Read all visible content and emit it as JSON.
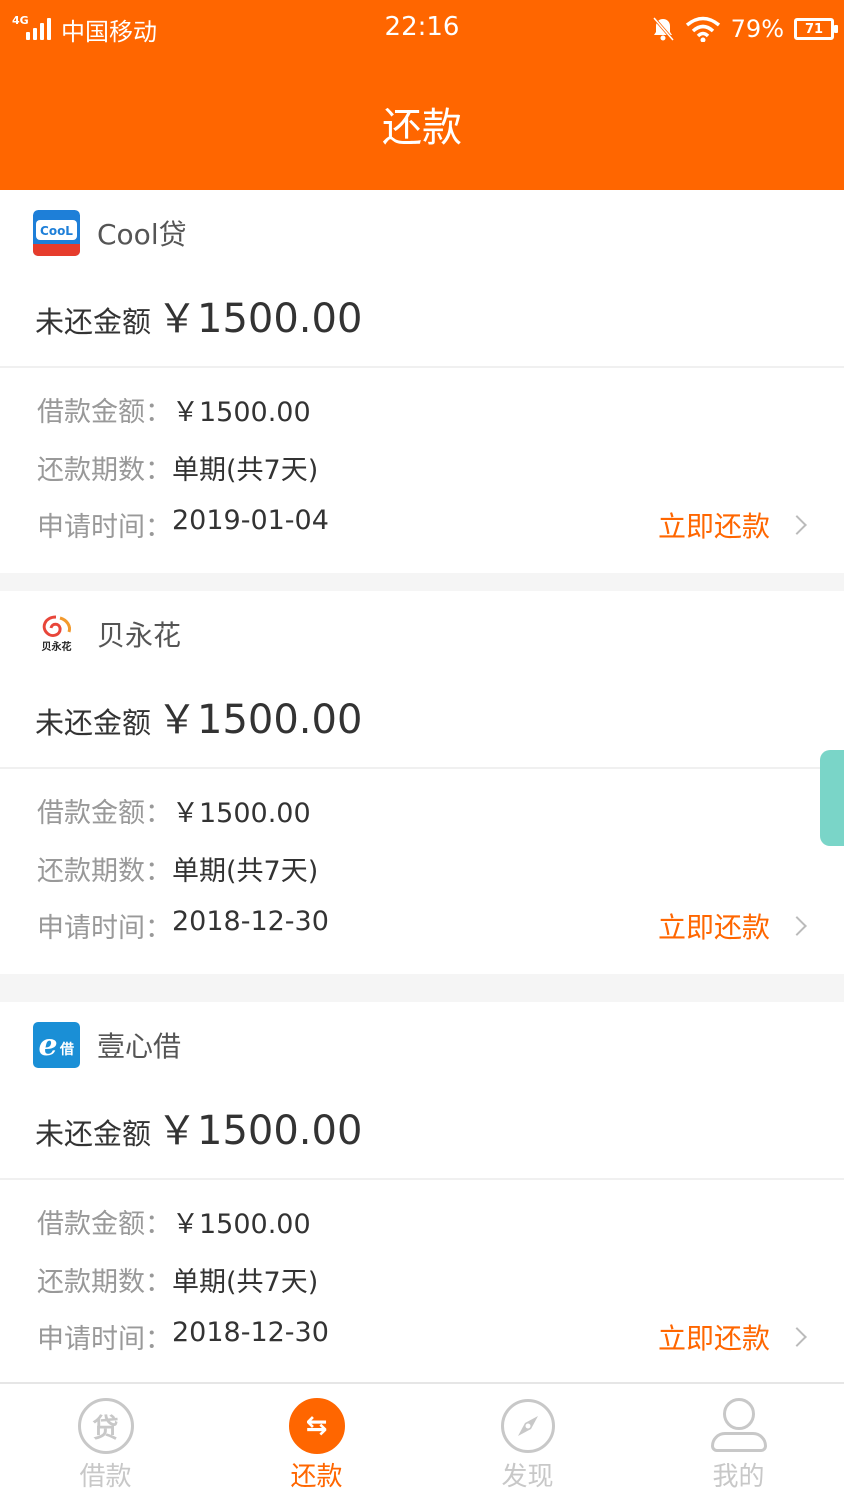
{
  "status": {
    "network": "4G",
    "carrier": "中国移动",
    "time": "22:16",
    "battery": "79%",
    "battery_level": 71
  },
  "header": {
    "title": "还款"
  },
  "labels": {
    "owed": "未还金额",
    "loan_amount": "借款金额：",
    "periods": "还款期数：",
    "apply_time": "申请时间：",
    "repay_button": "立即还款"
  },
  "loans": [
    {
      "platform": "Cool贷",
      "icon": "cool-dai-logo-icon",
      "owed": "￥1500.00",
      "loan_amount": "￥1500.00",
      "periods": "单期(共7天)",
      "apply_date": "2019-01-04"
    },
    {
      "platform": "贝永花",
      "icon": "bei-yong-hua-logo-icon",
      "owed": "￥1500.00",
      "loan_amount": "￥1500.00",
      "periods": "单期(共7天)",
      "apply_date": "2018-12-30"
    },
    {
      "platform": "壹心借",
      "icon": "yi-xin-jie-logo-icon",
      "owed": "￥1500.00",
      "loan_amount": "￥1500.00",
      "periods": "单期(共7天)",
      "apply_date": "2018-12-30"
    }
  ],
  "tabbar": {
    "items": [
      {
        "label": "借款",
        "icon": "loan-icon",
        "glyph": "贷"
      },
      {
        "label": "还款",
        "icon": "repay-icon",
        "glyph": "⇆",
        "active": true
      },
      {
        "label": "发现",
        "icon": "compass-icon"
      },
      {
        "label": "我的",
        "icon": "profile-icon"
      }
    ]
  },
  "colors": {
    "accent": "#ff6600",
    "side_tab": "#7ad5c8"
  }
}
